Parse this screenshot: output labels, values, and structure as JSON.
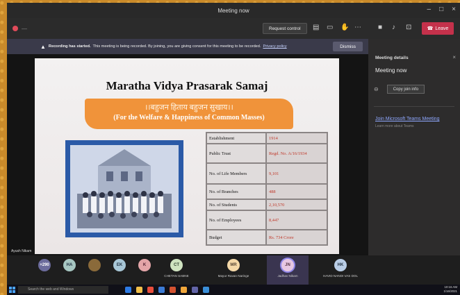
{
  "window": {
    "title": "Meeting now"
  },
  "toolbar": {
    "request_control": "Request control",
    "leave": "Leave",
    "colors": {
      "leave": "#c4314b",
      "recording": "#e14b5a"
    }
  },
  "banner": {
    "bold": "Recording has started.",
    "message": "This meeting is being recorded. By joining, you are giving consent for this meeting to be recorded.",
    "policy": "Privacy policy",
    "dismiss": "Dismiss"
  },
  "slide": {
    "title": "Maratha Vidya Prasarak Samaj",
    "motto": "।।बहुजन हिताय बहुजन सुखाय।।",
    "subtitle": "(For the Welfare & Happiness of Common Masses)",
    "rows": [
      {
        "label": "Establishment",
        "value": "1914"
      },
      {
        "label": "Public Trust",
        "value": "Regd. No. A/16/1934"
      },
      {
        "label": "No. of Life Members",
        "value": "9,101"
      },
      {
        "label": "No. of Branches",
        "value": "488"
      },
      {
        "label": "No. of Students",
        "value": "2,10,570"
      },
      {
        "label": "No. of Employees",
        "value": "8,447"
      },
      {
        "label": "Budget",
        "value": "Rs. 734 Crore"
      }
    ]
  },
  "presenter": {
    "name": "Ayush Nikam"
  },
  "meeting_details": {
    "heading": "Meeting details",
    "title": "Meeting now",
    "copy_join_info": "Copy join info",
    "join_link": "Join Microsoft Teams Meeting",
    "learn_more": "Learn more about Teams"
  },
  "participants": [
    {
      "initials": "+290",
      "name": "",
      "color": "#6b6b9c"
    },
    {
      "initials": "HA",
      "name": "",
      "color": "#a7c7c2"
    },
    {
      "initials": "",
      "name": "",
      "color": "#8a6a3a"
    },
    {
      "initials": "EK",
      "name": "",
      "color": "#a8c7d7"
    },
    {
      "initials": "K",
      "name": "",
      "color": "#e4a5a8"
    },
    {
      "initials": "CT",
      "name": "CHETAN SABNE",
      "color": "#cfe3c0"
    },
    {
      "initials": "MR",
      "name": "Mayur Ravan Naringe",
      "color": "#f4d8a8"
    },
    {
      "initials": "JN",
      "name": "Jadhav Nikam",
      "color": "#e7c7e2"
    },
    {
      "initials": "HK",
      "name": "HAVID NANDI VAS DOL",
      "color": "#b9cde6"
    }
  ],
  "taskbar": {
    "search": "Search the web and Windows",
    "time": "10:16 AM",
    "date": "1/16/2021"
  }
}
